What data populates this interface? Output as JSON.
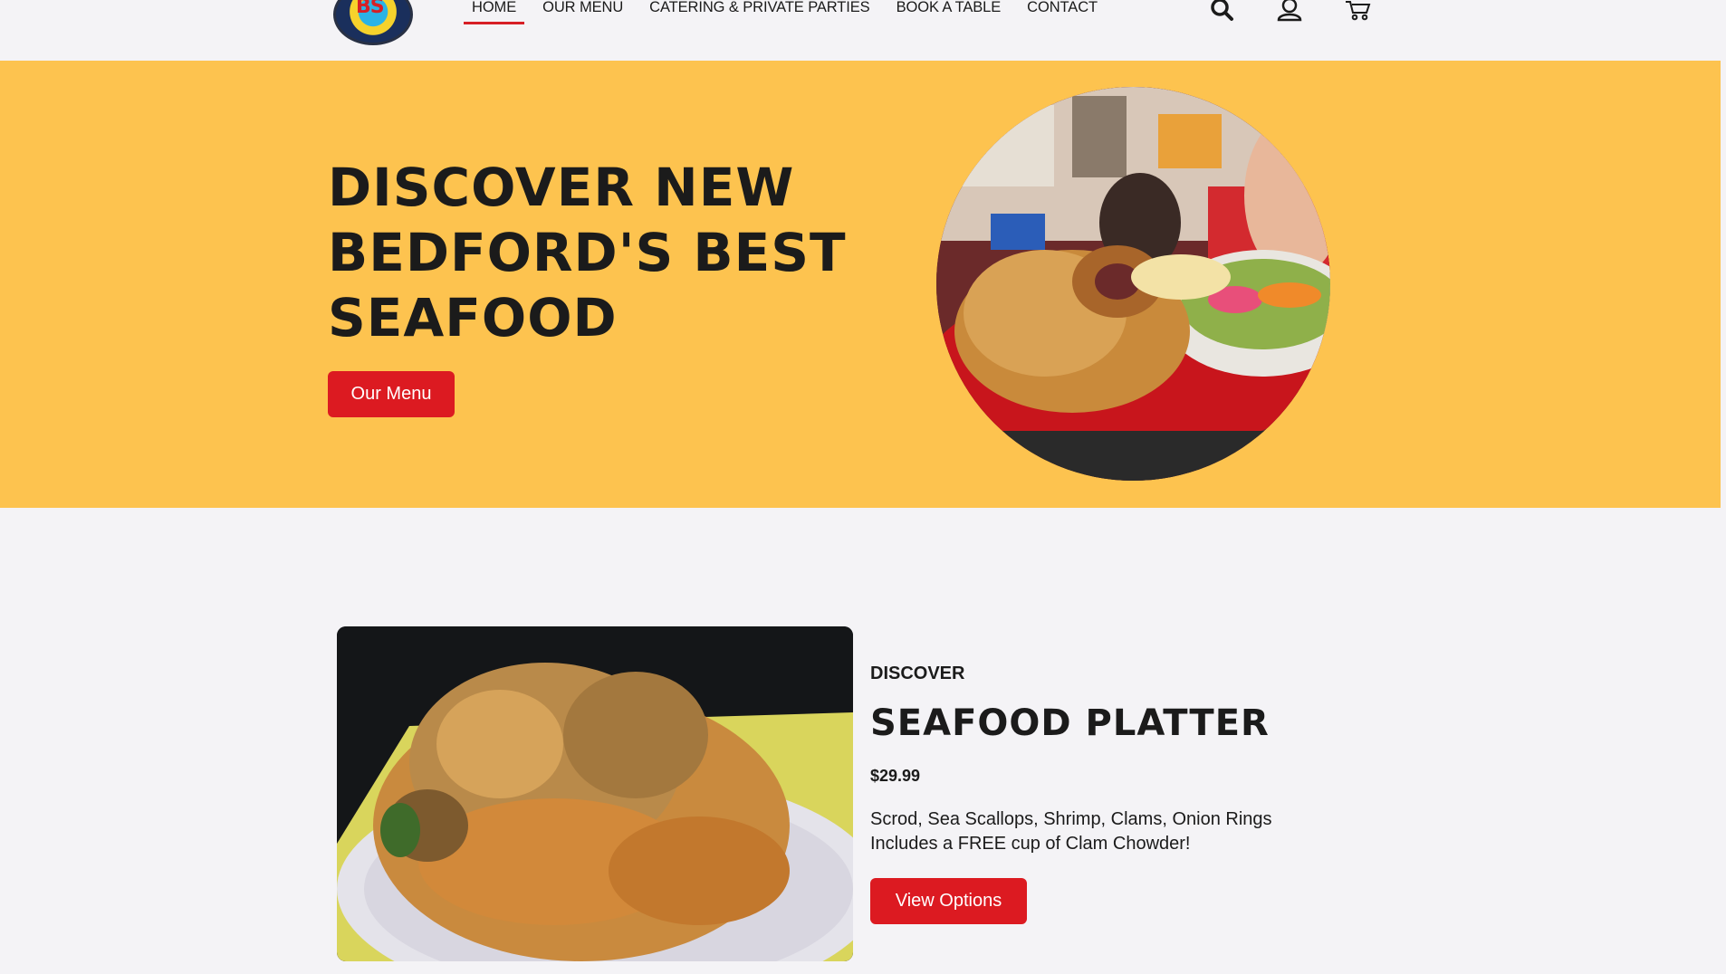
{
  "header": {
    "logo_text": "BS",
    "nav": [
      {
        "label": "HOME",
        "active": true
      },
      {
        "label": "OUR MENU",
        "active": false
      },
      {
        "label": "CATERING & PRIVATE PARTIES",
        "active": false
      },
      {
        "label": "BOOK A TABLE",
        "active": false
      },
      {
        "label": "CONTACT",
        "active": false
      }
    ],
    "icons": [
      "search-icon",
      "user-icon",
      "cart-icon"
    ]
  },
  "hero": {
    "title": "DISCOVER NEW BEDFORD'S BEST SEAFOOD",
    "button_label": "Our Menu",
    "image": "fried-seafood-plate-photo"
  },
  "product": {
    "eyebrow": "DISCOVER",
    "title": "SEAFOOD PLATTER",
    "price": "$29.99",
    "description_line1": "Scrod, Sea Scallops, Shrimp, Clams, Onion Rings",
    "description_line2": "Includes a FREE cup of Clam Chowder!",
    "button_label": "View Options",
    "image": "seafood-platter-photo"
  },
  "colors": {
    "accent_red": "#dc1a21",
    "hero_yellow": "#fdc34f",
    "background": "#f4f3f6",
    "text": "#1b1b1b"
  }
}
